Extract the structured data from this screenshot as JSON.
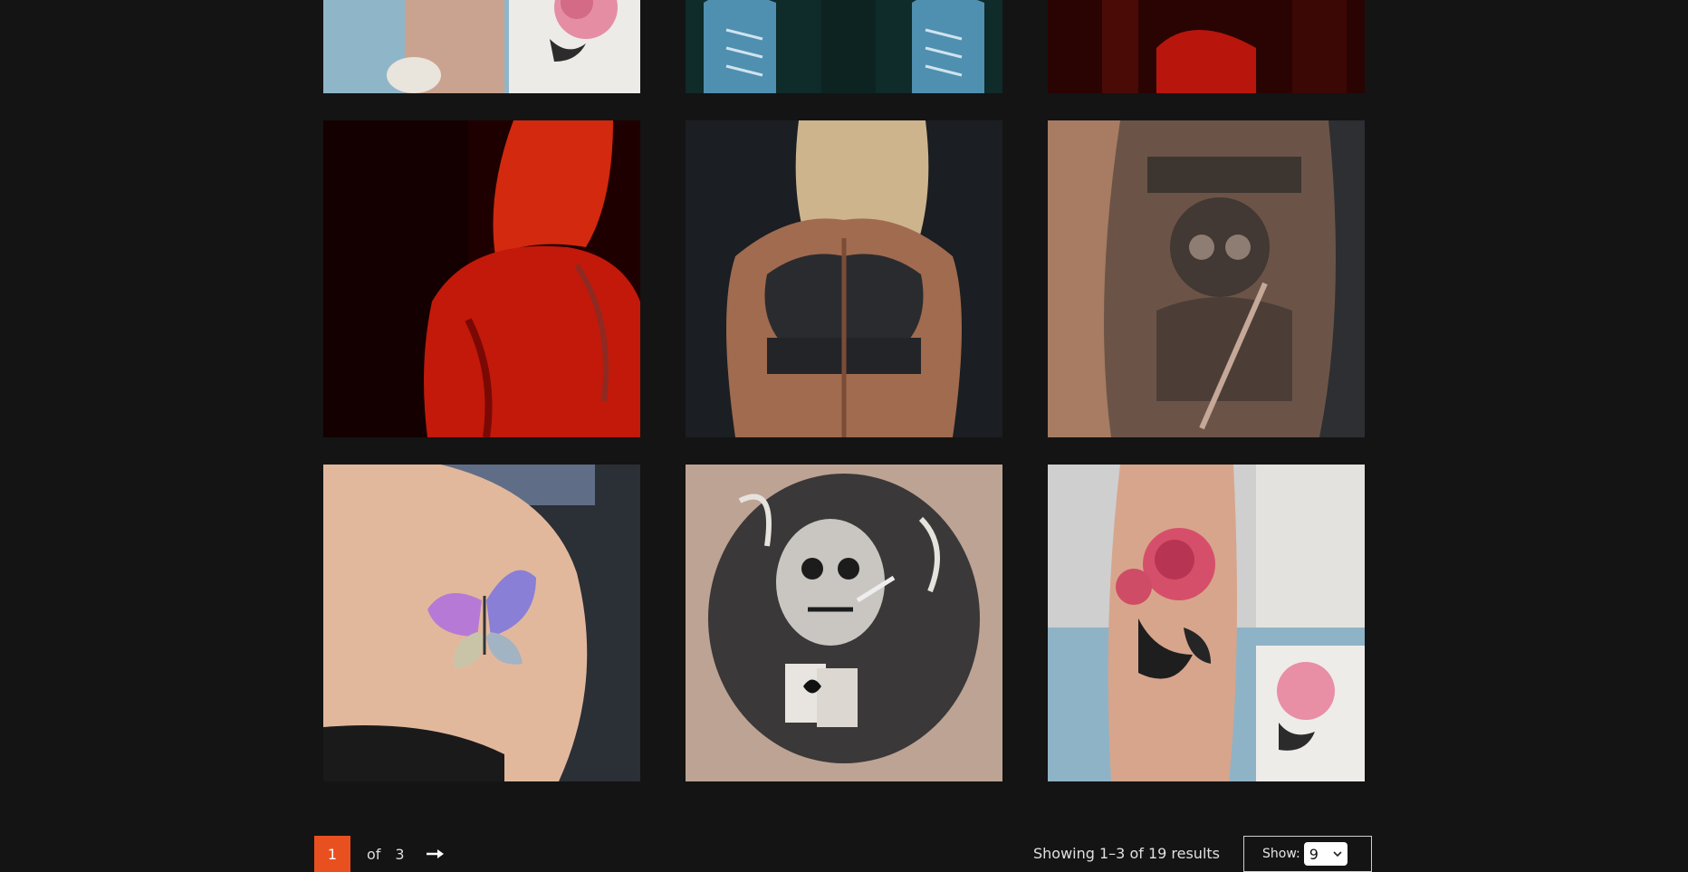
{
  "gallery": {
    "images": [
      {
        "icon": "rose-leg-tattoo-photo"
      },
      {
        "icon": "sneakers-photo"
      },
      {
        "icon": "red-light-photo"
      },
      {
        "icon": "red-hair-back-photo"
      },
      {
        "icon": "athletic-back-photo"
      },
      {
        "icon": "gladiator-sleeve-tattoo-photo"
      },
      {
        "icon": "butterfly-shoulder-tattoo-photo"
      },
      {
        "icon": "skull-chest-tattoo-photo"
      },
      {
        "icon": "rose-leg-tattoo-photo"
      }
    ]
  },
  "pagination": {
    "current": "1",
    "of_label": "of",
    "total": "3",
    "next_icon": "arrow-right-icon"
  },
  "results": {
    "text": "Showing 1–3 of 19 results"
  },
  "show": {
    "label": "Show:",
    "value": "9"
  },
  "colors": {
    "background": "#141414",
    "accent": "#e8511f"
  }
}
